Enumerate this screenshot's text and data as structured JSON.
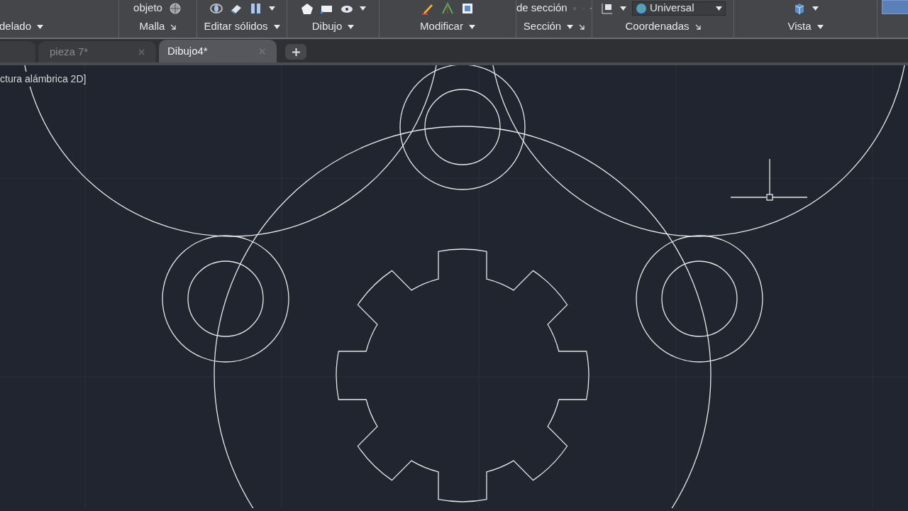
{
  "ribbon": {
    "panels": [
      {
        "label": "delado",
        "menu": true,
        "launcher": false
      },
      {
        "label": "Malla",
        "top_text": "objeto",
        "menu": false,
        "launcher": true
      },
      {
        "label": "Editar sólidos",
        "menu": true,
        "launcher": false
      },
      {
        "label": "Dibujo",
        "menu": true,
        "launcher": false
      },
      {
        "label": "Modificar",
        "menu": true,
        "launcher": false
      },
      {
        "label": "Sección",
        "top_text": "de sección",
        "menu": true,
        "launcher": true
      },
      {
        "label": "Coordenadas",
        "dropdown": "Universal",
        "menu": false,
        "launcher": true
      },
      {
        "label": "Vista",
        "menu": true,
        "launcher": false
      }
    ]
  },
  "tabs": [
    {
      "label": "pieza 7*",
      "selected": false
    },
    {
      "label": "Dibujo4*",
      "selected": true
    }
  ],
  "viewport_label": "ctura alámbrica 2D]"
}
